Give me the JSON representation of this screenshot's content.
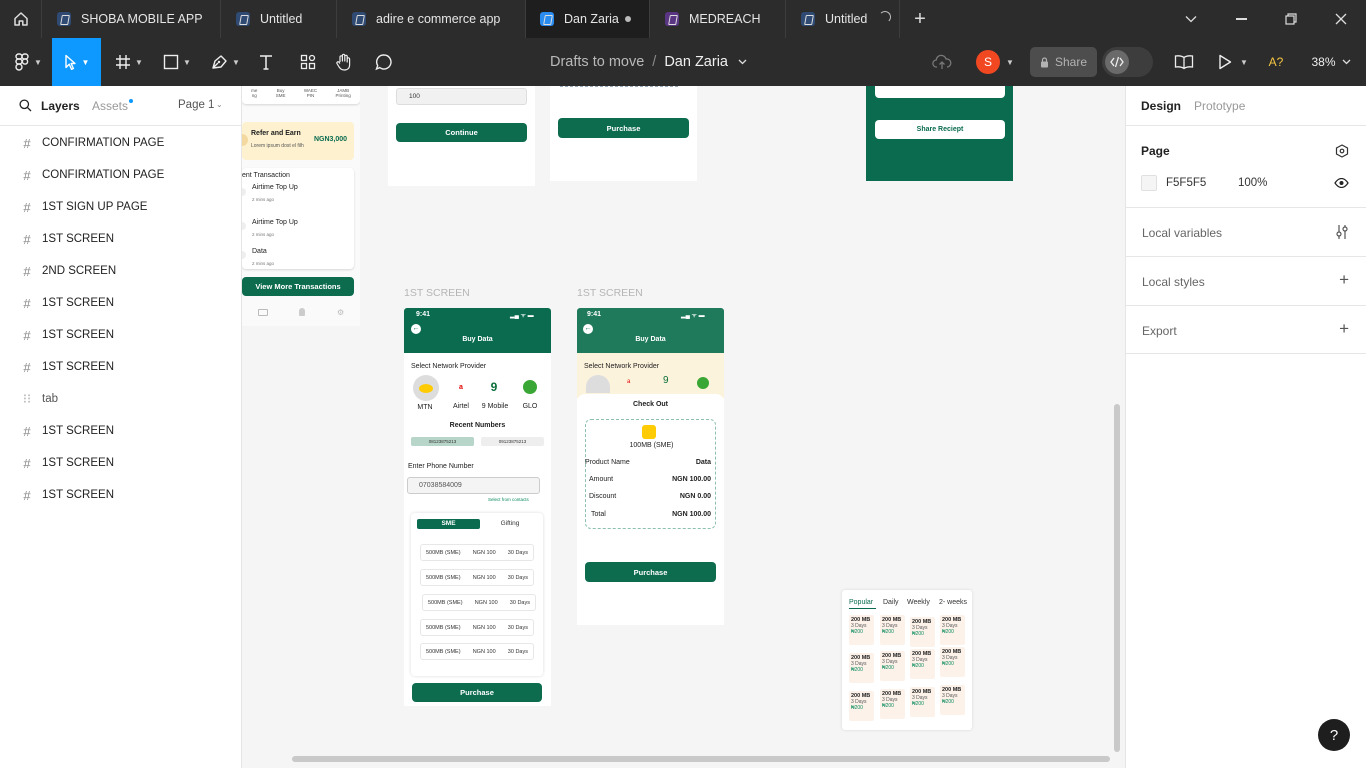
{
  "tabs": [
    {
      "label": "SHOBA MOBILE APP",
      "color": "#2f4b74"
    },
    {
      "label": "Untitled",
      "color": "#2f4b74"
    },
    {
      "label": "adire e commerce app",
      "color": "#2f4b74"
    },
    {
      "label": "Dan Zaria",
      "color": "#2b8cf0"
    },
    {
      "label": "MEDREACH",
      "color": "#5a3584"
    },
    {
      "label": "Untitled",
      "color": "#2f4b74"
    }
  ],
  "toolbar": {
    "breadcrumb_project": "Drafts to move",
    "breadcrumb_separator": "/",
    "file_name": "Dan Zaria",
    "avatar_initial": "S",
    "share_label": "Share",
    "font_badge": "A?",
    "zoom": "38%"
  },
  "leftpanel": {
    "tab_layers": "Layers",
    "tab_assets": "Assets",
    "page_selector": "Page 1",
    "layers": [
      "CONFIRMATION PAGE",
      "CONFIRMATION PAGE",
      "1ST SIGN UP PAGE",
      "1ST SCREEN",
      "2ND SCREEN",
      "1ST SCREEN",
      "1ST SCREEN",
      "1ST SCREEN",
      "tab",
      "1ST SCREEN",
      "1ST SCREEN",
      "1ST SCREEN"
    ]
  },
  "rightpanel": {
    "tab_design": "Design",
    "tab_prototype": "Prototype",
    "page_heading": "Page",
    "page_color": "F5F5F5",
    "page_opacity": "100%",
    "local_variables": "Local variables",
    "local_styles": "Local styles",
    "export": "Export"
  },
  "canvas": {
    "home_frame": {
      "quick_labels": [
        "me\nng",
        "Buy\nSME",
        "WAEC\nPIN",
        "JAMB\nPrinting"
      ],
      "refer_title": "Refer and Earn",
      "refer_sub": "Lorem ipsum dost el filh",
      "refer_amount": "NGN3,000",
      "recent_title": "ent Transaction",
      "transactions": [
        {
          "name": "Airtime Top Up",
          "time": "2 mins ago"
        },
        {
          "name": "Airtime Top Up",
          "time": "2 mins ago"
        },
        {
          "name": "Data",
          "time": "2 mins ago"
        }
      ],
      "view_more": "View More Transactions"
    },
    "top_frame_a": {
      "input_value": "100",
      "button": "Continue"
    },
    "top_frame_b": {
      "button": "Purchase"
    },
    "top_frame_c": {
      "button": "Share Reciept"
    },
    "frame_labels": [
      "1ST SCREEN",
      "1ST SCREEN"
    ],
    "buy_data": {
      "time": "9:41",
      "title": "Buy Data",
      "select_network": "Select Network Provider",
      "networks": [
        "MTN",
        "Airtel",
        "9 Mobile",
        "GLO"
      ],
      "recent_numbers": "Recent Numbers",
      "recent": [
        "08123875213",
        "09123875213"
      ],
      "enter_phone": "Enter Phone Number",
      "phone_value": "07038584009",
      "select_contacts": "Select from contacts",
      "plan_tabs": [
        "SME",
        "Gifting"
      ],
      "plans": [
        [
          "500MB (SME)",
          "NGN 100",
          "30 Days"
        ],
        [
          "500MB (SME)",
          "NGN 100",
          "30 Days"
        ],
        [
          "500MB (SME)",
          "NGN 100",
          "30 Days"
        ],
        [
          "500MB (SME)",
          "NGN 100",
          "30 Days"
        ],
        [
          "500MB (SME)",
          "NGN 100",
          "30 Days"
        ]
      ],
      "purchase": "Purchase"
    },
    "checkout": {
      "time": "9:41",
      "title": "Buy Data",
      "select_network": "Select Network Provider",
      "heading": "Check Out",
      "plan": "100MB (SME)",
      "rows": [
        [
          "Product Name",
          "Data"
        ],
        [
          "Amount",
          "NGN 100.00"
        ],
        [
          "Discount",
          "NGN 0.00"
        ],
        [
          "Total",
          "NGN 100.00"
        ]
      ],
      "purchase": "Purchase"
    },
    "plans_frame": {
      "tabs": [
        "Popular",
        "Daily",
        "Weekly",
        "2- weeks"
      ],
      "card_size": "200 MB",
      "card_days": "3 Days",
      "card_price": "₦200"
    }
  },
  "colors": {
    "brand_green": "#0a6b4f",
    "figma_blue": "#0d99ff",
    "avatar": "#f24822"
  }
}
